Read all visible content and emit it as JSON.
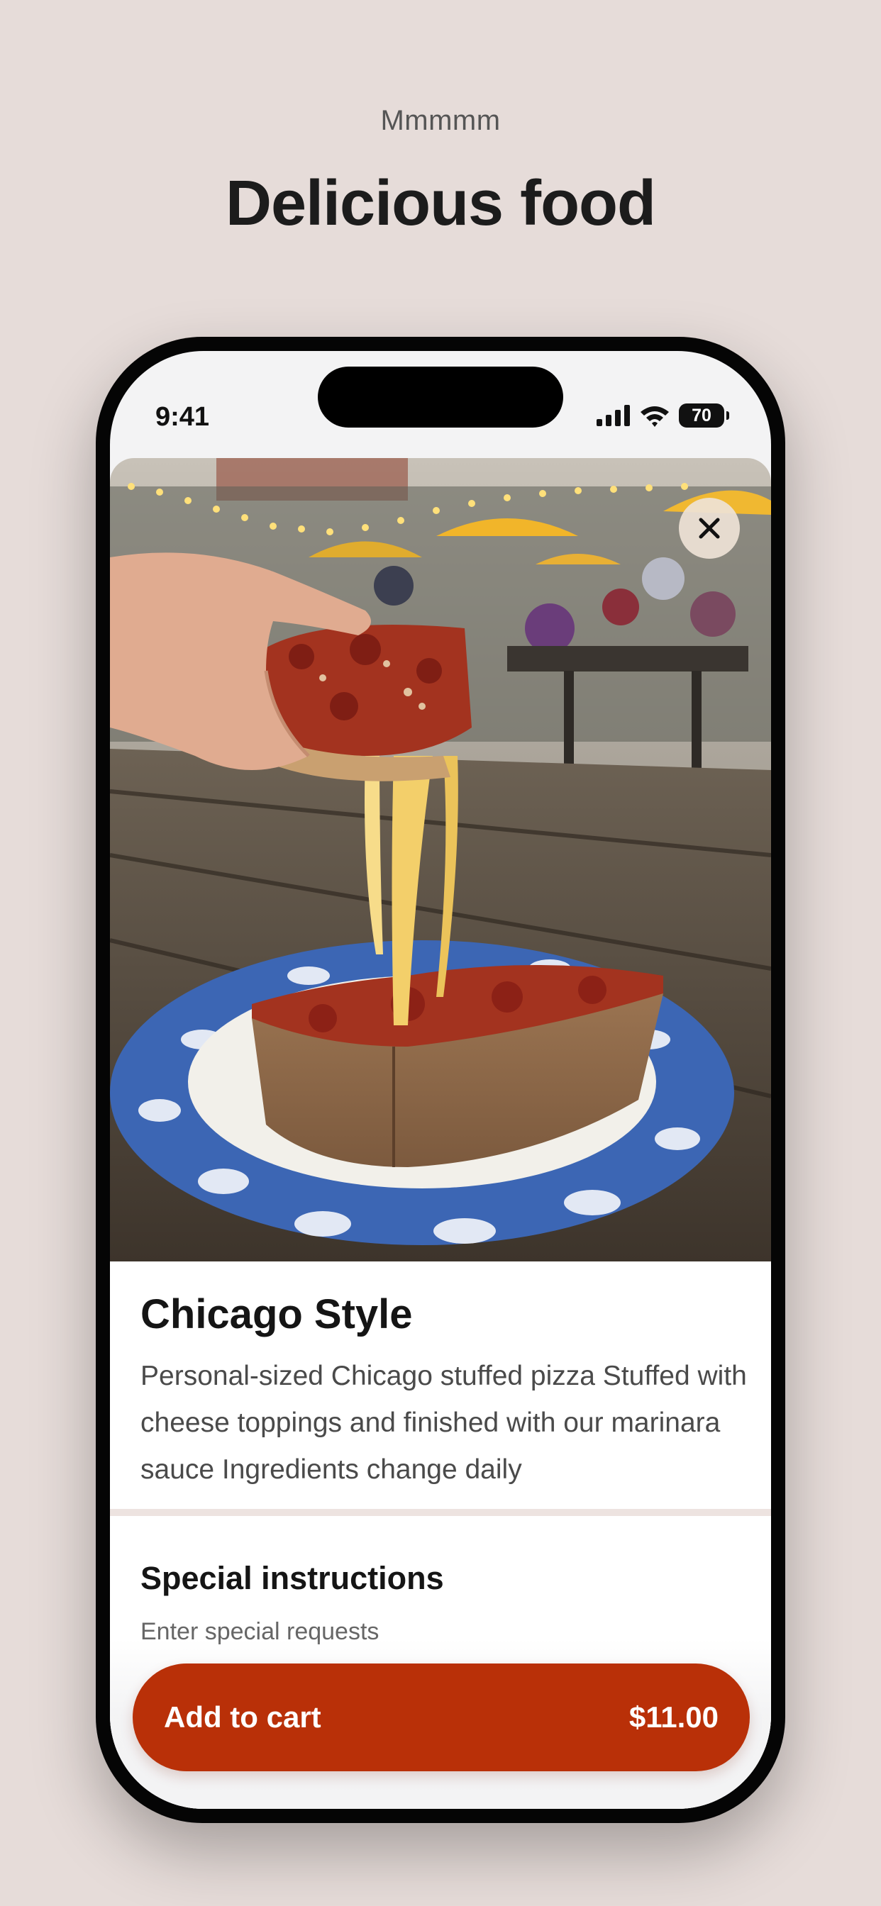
{
  "promo": {
    "eyebrow": "Mmmmm",
    "headline": "Delicious food"
  },
  "status_bar": {
    "time": "9:41",
    "battery": "70",
    "icons": [
      "signal-icon",
      "wifi-icon",
      "battery-icon"
    ]
  },
  "item": {
    "image_icon": "food-photo",
    "close_icon": "close-icon",
    "title": "Chicago Style",
    "description": "Personal-sized Chicago stuffed pizza Stuffed with cheese toppings and finished with our marinara sauce Ingredients change daily"
  },
  "special_instructions": {
    "title": "Special instructions",
    "placeholder": "Enter special requests"
  },
  "cart": {
    "label": "Add to cart",
    "price": "$11.00"
  },
  "colors": {
    "background": "#e6dcd9",
    "accent": "#b93008",
    "text": "#1a1a1a"
  }
}
